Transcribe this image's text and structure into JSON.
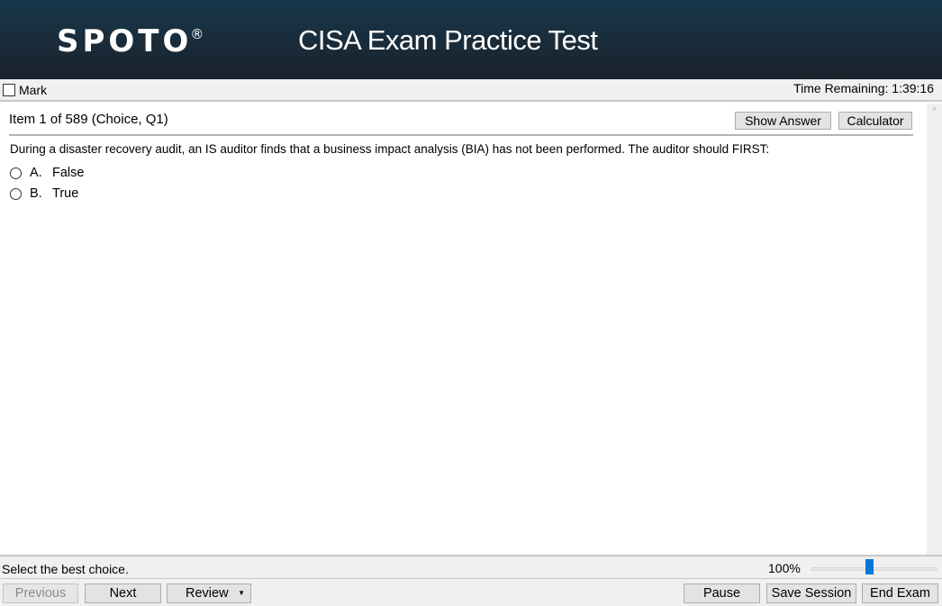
{
  "header": {
    "logo_text": "SPOTO",
    "logo_mark": "®",
    "title": "CISA Exam Practice Test"
  },
  "toolbar": {
    "mark_label": "Mark",
    "mark_checked": false,
    "time_remaining": "Time Remaining: 1:39:16"
  },
  "item": {
    "title": "Item 1 of 589 (Choice, Q1)",
    "show_answer_label": "Show Answer",
    "calculator_label": "Calculator",
    "question": "During a disaster recovery audit, an IS auditor finds that a business impact analysis (BIA) has not been performed. The auditor should FIRST:",
    "options": [
      {
        "letter": "A.",
        "text": "False",
        "selected": false
      },
      {
        "letter": "B.",
        "text": "True",
        "selected": false
      }
    ]
  },
  "scrollbar": {
    "up_icon": "chevron-up-icon",
    "up_glyph": "^"
  },
  "status": {
    "instruction": "Select the best choice.",
    "zoom_level": "100%",
    "zoom_slider_fraction": 0.46
  },
  "nav": {
    "previous_label": "Previous",
    "previous_disabled": true,
    "next_label": "Next",
    "review_label": "Review",
    "review_caret": "▼",
    "pause_label": "Pause",
    "save_session_label": "Save Session",
    "end_exam_label": "End Exam"
  }
}
